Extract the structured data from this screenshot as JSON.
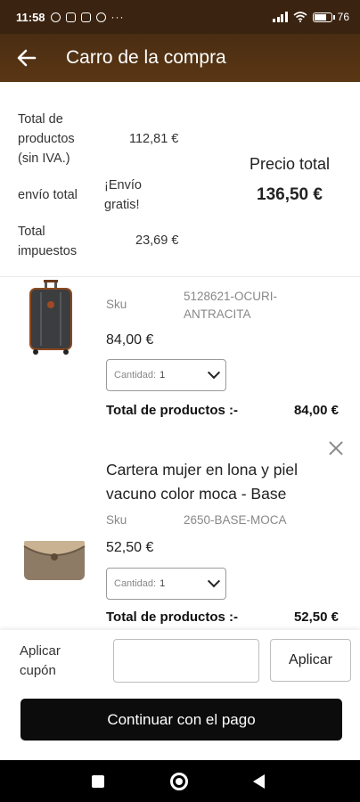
{
  "status_bar": {
    "time": "11:58",
    "more": "···",
    "battery": "76"
  },
  "header": {
    "title": "Carro de la compra",
    "back_icon": "arrow-left-icon"
  },
  "summary": {
    "products_label": [
      "Total de",
      "productos",
      "(sin IVA.)"
    ],
    "products_value": "112,81 €",
    "shipping_label": "envío total",
    "shipping_value": [
      "¡Envío",
      "gratis!"
    ],
    "taxes_label": [
      "Total",
      "impuestos"
    ],
    "taxes_value": "23,69 €",
    "total_label": "Precio total",
    "total_value": "136,50 €"
  },
  "items": [
    {
      "name": "",
      "sku_label": "Sku",
      "sku": [
        "5128621-OCURI-",
        "ANTRACITA"
      ],
      "price": "84,00 €",
      "qty_label": "Cantidad:",
      "qty": "1",
      "total_label": "Total de productos :-",
      "total": "84,00 €",
      "image": "suitcase-image"
    },
    {
      "name": [
        "Cartera mujer en lona y piel",
        "vacuno color moca - Base"
      ],
      "sku_label": "Sku",
      "sku": [
        "2650-BASE-MOCA"
      ],
      "price": "52,50 €",
      "qty_label": "Cantidad:",
      "qty": "1",
      "total_label": "Total de productos :-",
      "total": "52,50 €",
      "image": "wallet-image"
    }
  ],
  "coupon": {
    "label": [
      "Aplicar",
      "cupón"
    ],
    "input_value": "",
    "apply_label": "Aplicar"
  },
  "checkout": {
    "button_label": "Continuar con el pago"
  },
  "colors": {
    "header_bg": "#5a3714",
    "primary_button": "#0c0c0c"
  }
}
